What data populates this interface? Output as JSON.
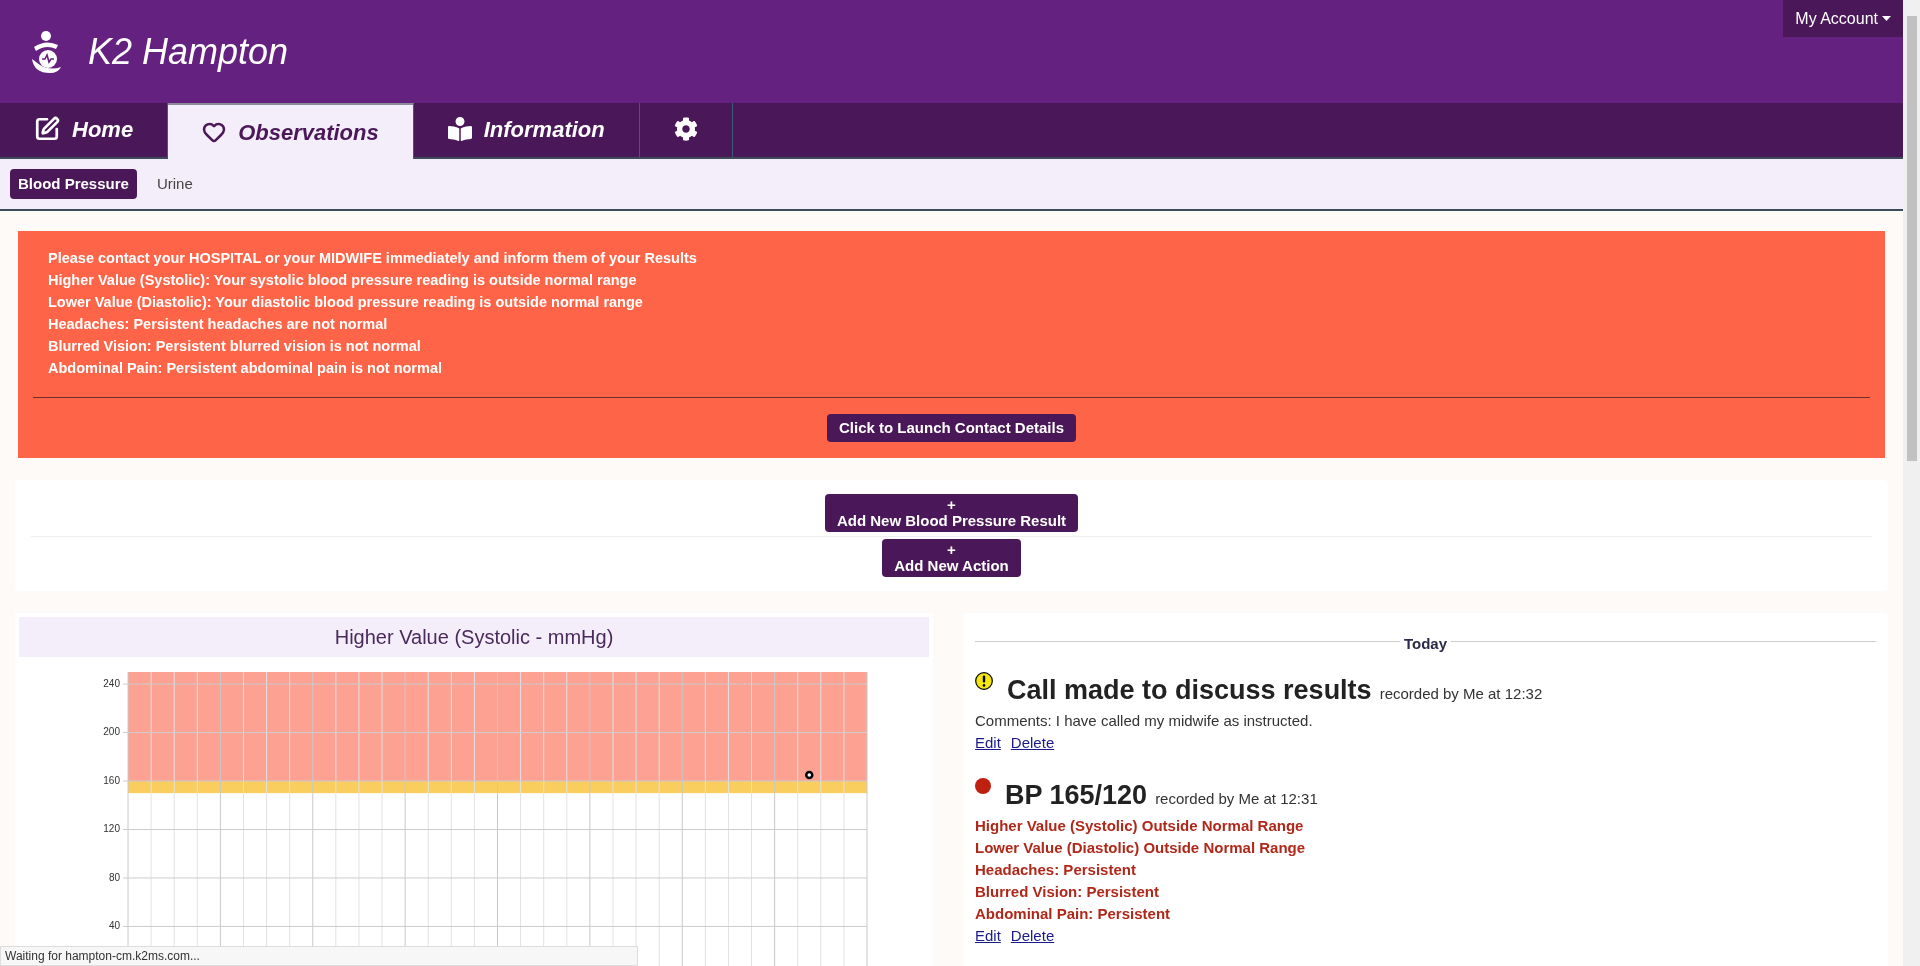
{
  "header": {
    "title": "K2 Hampton",
    "account_menu": "My Account"
  },
  "tabs": [
    {
      "label": "Home",
      "selected": false
    },
    {
      "label": "Observations",
      "selected": true
    },
    {
      "label": "Information",
      "selected": false
    },
    {
      "selected": false
    }
  ],
  "subnav": [
    {
      "label": "Blood Pressure",
      "selected": true
    },
    {
      "label": "Urine",
      "selected": false
    }
  ],
  "alert": {
    "lines": [
      "Please contact your HOSPITAL or your MIDWIFE immediately and inform them of your Results",
      "Higher Value (Systolic): Your systolic blood pressure reading is outside normal range",
      "Lower Value (Diastolic): Your diastolic blood pressure reading is outside normal range",
      "Headaches: Persistent headaches are not normal",
      "Blurred Vision: Persistent blurred vision is not normal",
      "Abdominal Pain: Persistent abdominal pain is not normal"
    ],
    "button": "Click to Launch Contact Details"
  },
  "actions": [
    {
      "icon": "+",
      "label": "Add New Blood Pressure Result"
    },
    {
      "icon": "+",
      "label": "Add New Action"
    }
  ],
  "chart": {
    "title": "Higher Value (Systolic - mmHg)",
    "chart_data": {
      "type": "scatter",
      "ylim": [
        -10,
        250
      ],
      "yticks": [
        40,
        80,
        120,
        160,
        200,
        240
      ],
      "categories": [
        null,
        null,
        null,
        null,
        null,
        null,
        null,
        null,
        null,
        null,
        null,
        null,
        null,
        null,
        null,
        null,
        null,
        null,
        null,
        null,
        null,
        null,
        null,
        null,
        null,
        null,
        null,
        null,
        null,
        null,
        null,
        null
      ],
      "series": [
        {
          "color": "#000000",
          "values": [
            null,
            null,
            null,
            null,
            null,
            null,
            null,
            null,
            null,
            null,
            null,
            null,
            null,
            null,
            null,
            null,
            null,
            null,
            null,
            null,
            null,
            null,
            null,
            null,
            null,
            null,
            null,
            null,
            null,
            165,
            null,
            null
          ]
        }
      ],
      "grid": true,
      "bands": [
        {
          "axis": "y",
          "from": 160,
          "to": 250,
          "color": "#fda193"
        },
        {
          "axis": "y",
          "from": 150,
          "to": 160,
          "color": "#f9cd5e"
        }
      ]
    }
  },
  "timeline": {
    "day": "Today",
    "entries": [
      {
        "kind": "action",
        "color": "#f5e70c",
        "title": "Call made to discuss results",
        "meta": "recorded by Me at 12:32",
        "details": [
          "Comments: I have called my midwife as instructed."
        ],
        "links": [
          "Edit",
          "Delete"
        ]
      },
      {
        "kind": "reading",
        "color": "#c0200f",
        "title": "BP 165/120",
        "meta": "recorded by Me at 12:31",
        "details": [
          "Higher Value (Systolic) Outside Normal Range",
          "Lower Value (Diastolic) Outside Normal Range",
          "Headaches: Persistent",
          "Blurred Vision: Persistent",
          "Abdominal Pain: Persistent"
        ],
        "links": [
          "Edit",
          "Delete"
        ]
      }
    ]
  },
  "status_bar": "Waiting for hampton-cm.k2ms.com..."
}
